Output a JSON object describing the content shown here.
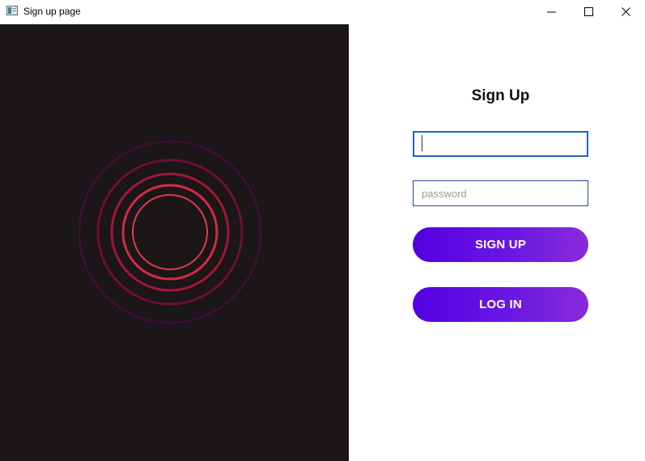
{
  "window": {
    "title": "Sign up page",
    "app_icon": "window-app-icon",
    "controls": [
      "minimize-icon",
      "maximize-icon",
      "close-icon"
    ]
  },
  "art": {
    "background": "#1b1617",
    "rings": [
      {
        "color": "#e23a4e"
      },
      {
        "color": "#d42b44"
      },
      {
        "color": "#a3153a"
      },
      {
        "color": "#6e0e38"
      },
      {
        "color": "#3b0f33"
      }
    ]
  },
  "form": {
    "heading": "Sign Up",
    "username": {
      "value": "",
      "placeholder": ""
    },
    "password": {
      "value": "",
      "placeholder": "password"
    },
    "signup_label": "SIGN UP",
    "login_label": "LOG IN"
  },
  "colors": {
    "button_gradient_start": "#5200e0",
    "button_gradient_end": "#8a2bd9",
    "field_border": "#2b4a8c",
    "focus_border": "#1f64c6"
  }
}
